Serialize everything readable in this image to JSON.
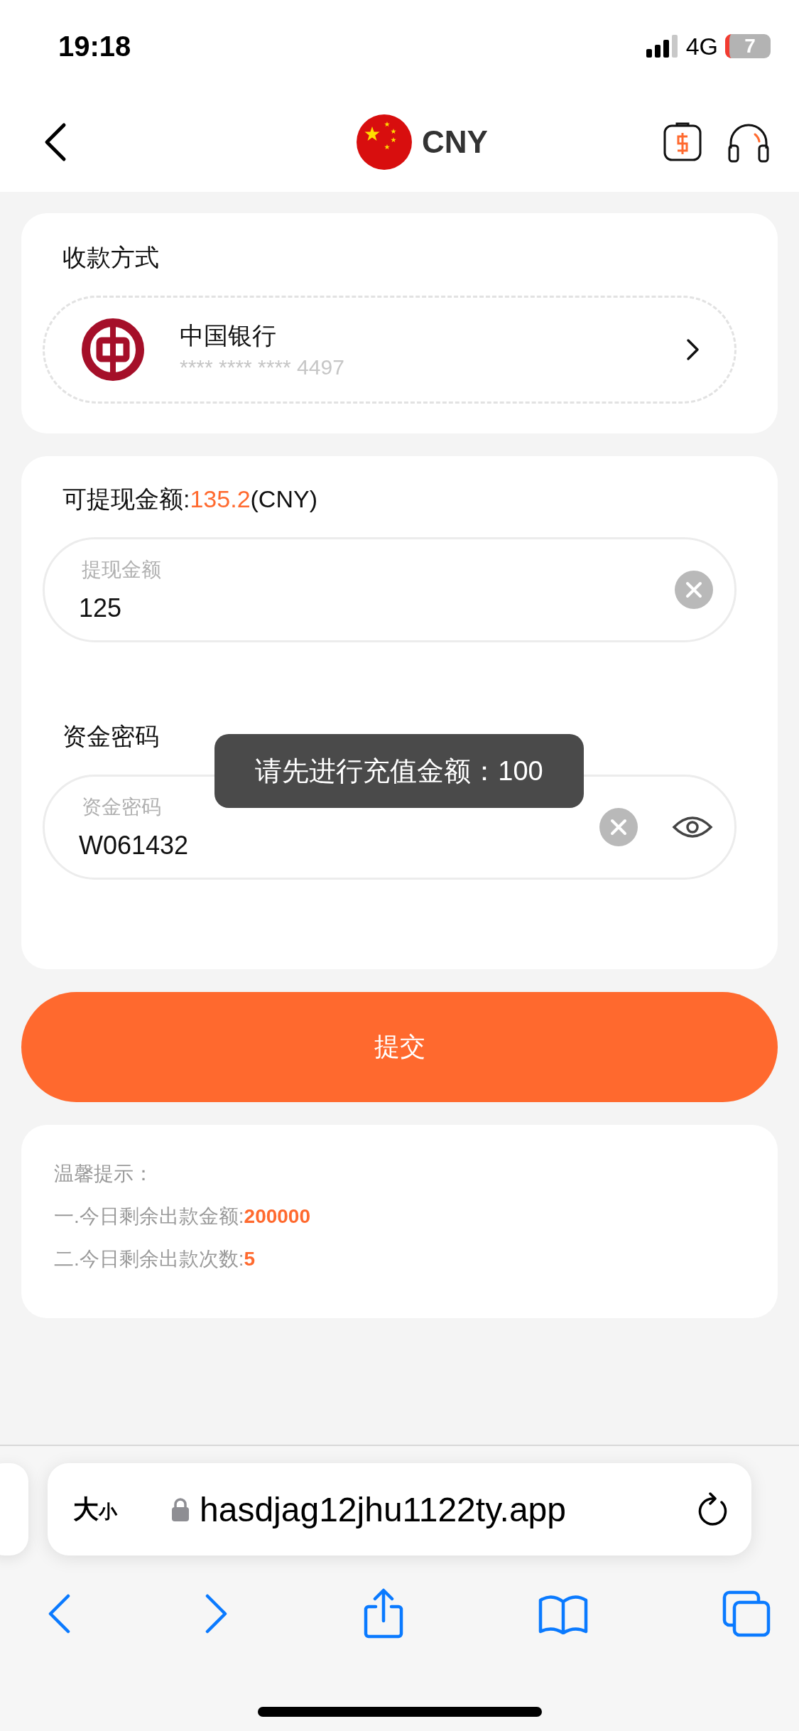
{
  "status_bar": {
    "time": "19:18",
    "network": "4G",
    "battery": "7"
  },
  "header": {
    "currency": "CNY"
  },
  "payment_method": {
    "title": "收款方式",
    "bank_name": "中国银行",
    "card_number": "**** **** **** 4497"
  },
  "withdraw": {
    "available_label": "可提现金额:",
    "available_value": "135.2",
    "available_suffix": "(CNY)",
    "amount_field": {
      "label": "提现金额",
      "value": "125"
    },
    "password_title": "资金密码",
    "password_field": {
      "label": "资金密码",
      "value": "W061432"
    }
  },
  "toast": "请先进行充值金额：100",
  "submit_button": "提交",
  "tips": {
    "title": "温馨提示：",
    "lines": [
      {
        "label": "一.今日剩余出款金额:",
        "value": "200000"
      },
      {
        "label": "二.今日剩余出款次数:",
        "value": "5"
      }
    ]
  },
  "browser": {
    "text_size_large": "大",
    "text_size_small": "小",
    "url": "hasdjag12jhu1122ty.app"
  }
}
